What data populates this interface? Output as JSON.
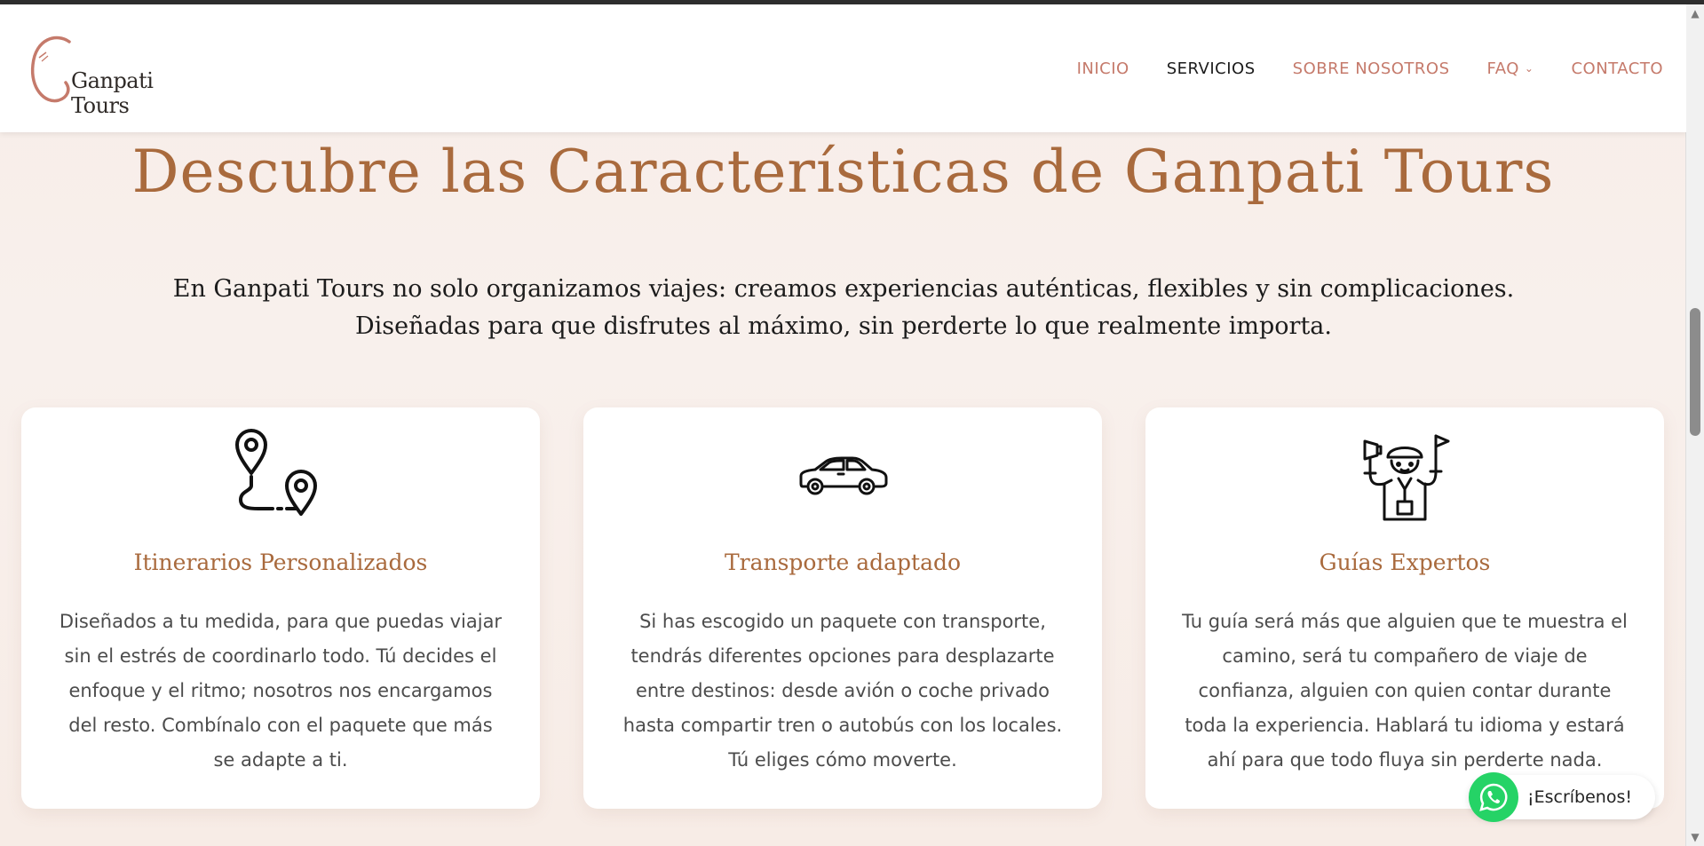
{
  "header": {
    "logo_text": "Ganpati Tours",
    "nav": [
      {
        "label": "INICIO"
      },
      {
        "label": "SERVICIOS"
      },
      {
        "label": "SOBRE NOSOTROS"
      },
      {
        "label": "FAQ"
      },
      {
        "label": "CONTACTO"
      }
    ]
  },
  "hero": {
    "title": "Descubre las Características de Ganpati Tours",
    "intro_line1": "En Ganpati Tours no solo organizamos viajes: creamos experiencias auténticas, flexibles y sin complicaciones.",
    "intro_line2": "Diseñadas para que disfrutes al máximo, sin perderte lo que realmente importa."
  },
  "cards": [
    {
      "icon": "route-pins-icon",
      "title": "Itinerarios Personalizados",
      "text": "Diseñados a tu medida, para que puedas viajar sin el estrés de coordinarlo todo. Tú decides el enfoque y el ritmo; nosotros nos encargamos del resto. Combínalo con el paquete que más se adapte a ti."
    },
    {
      "icon": "car-icon",
      "title": "Transporte adaptado",
      "text": "Si has escogido un paquete con transporte, tendrás diferentes opciones para desplazarte entre destinos: desde avión o coche privado hasta compartir tren o autobús con los locales. Tú eliges cómo moverte."
    },
    {
      "icon": "tour-guide-icon",
      "title": "Guías Expertos",
      "text": "Tu guía será más que alguien que te muestra el camino, será tu compañero de viaje de confianza, alguien con quien contar durante toda la experiencia. Hablará tu idioma y estará ahí para que todo fluya sin perderte nada."
    }
  ],
  "whatsapp": {
    "label": "¡Escríbenos!"
  },
  "colors": {
    "accent": "#a96a3d",
    "nav": "#c57a6b",
    "whatsapp": "#25d366"
  }
}
